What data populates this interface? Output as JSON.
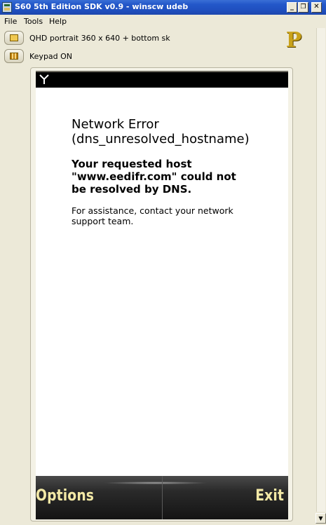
{
  "window": {
    "title": "S60 5th Edition SDK v0.9 - winscw udeb",
    "controls": {
      "minimize": "_",
      "restore": "❐",
      "close": "✕"
    }
  },
  "menu": [
    "File",
    "Tools",
    "Help"
  ],
  "toolbar": {
    "resolution_label": "QHD portrait 360 x 640 + bottom sk",
    "keypad_label": "Keypad ON",
    "logo_letter": "P"
  },
  "phone": {
    "error_title_line1": "Network Error",
    "error_title_line2": "(dns_unresolved_hostname)",
    "error_message": "Your requested host \"www.eedifr.com\" could not be resolved by DNS.",
    "help_text": "For assistance, contact your network support team.",
    "softkeys": {
      "left": "Options",
      "right": "Exit"
    }
  },
  "colors": {
    "titlebar": "#2357c9",
    "softkey_text": "#f3e9a6",
    "window_bg": "#ece9d8"
  }
}
